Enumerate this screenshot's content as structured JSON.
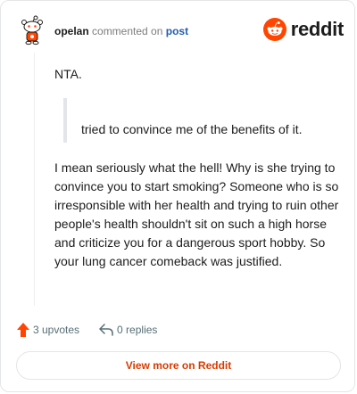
{
  "header": {
    "username": "opelan",
    "action_text": "commented on",
    "post_link": "post",
    "brand": "reddit"
  },
  "comment": {
    "first_line": "NTA.",
    "quote": "tried to convince me of the benefits of it.",
    "paragraph": "I mean seriously what the hell! Why is she trying to convince you to start smoking? Someone who is so irresponsible with her health and trying to ruin other people's health shouldn't sit on such a high horse and criticize you for a dangerous sport hobby. So your lung cancer comeback was justified."
  },
  "actions": {
    "upvotes": "3 upvotes",
    "replies": "0 replies"
  },
  "footer": {
    "view_more": "View more on Reddit"
  },
  "colors": {
    "brand_orange": "#ff4500",
    "link_blue": "#1f5fb0",
    "view_more_text": "#d93a00"
  },
  "icons": [
    "snoo-avatar-icon",
    "reddit-logo-icon",
    "upvote-arrow-icon",
    "reply-arrow-icon"
  ]
}
